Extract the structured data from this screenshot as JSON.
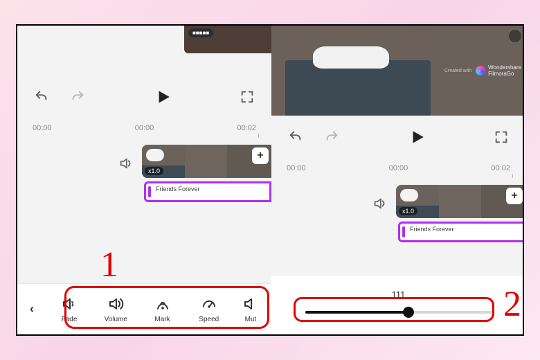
{
  "annotations": {
    "step1": "1",
    "step2": "2"
  },
  "watermark": {
    "prefix": "Created with",
    "brand_line1": "Wondershare",
    "brand_line2": "FilmoraGo"
  },
  "left": {
    "transport": {
      "time_start": "00:00",
      "time_mid": "00:00",
      "time_end": "00:02"
    },
    "clip": {
      "speed_tag": "x1.0",
      "plus": "+",
      "audio_label": "Friends Forever"
    },
    "toolbar": {
      "back": "‹",
      "items": [
        {
          "id": "fade",
          "label": "Fade"
        },
        {
          "id": "volume",
          "label": "Volume"
        },
        {
          "id": "mark",
          "label": "Mark"
        },
        {
          "id": "speed",
          "label": "Speed"
        },
        {
          "id": "mute",
          "label": "Mut"
        }
      ]
    }
  },
  "right": {
    "transport": {
      "time_start": "00:00",
      "time_mid": "00:00",
      "time_end": "00:02"
    },
    "clip": {
      "speed_tag": "x1.0",
      "plus": "+",
      "audio_label": "Friends Forever"
    },
    "slider": {
      "value_label": "111",
      "min": 0,
      "max": 200,
      "value": 111
    }
  }
}
